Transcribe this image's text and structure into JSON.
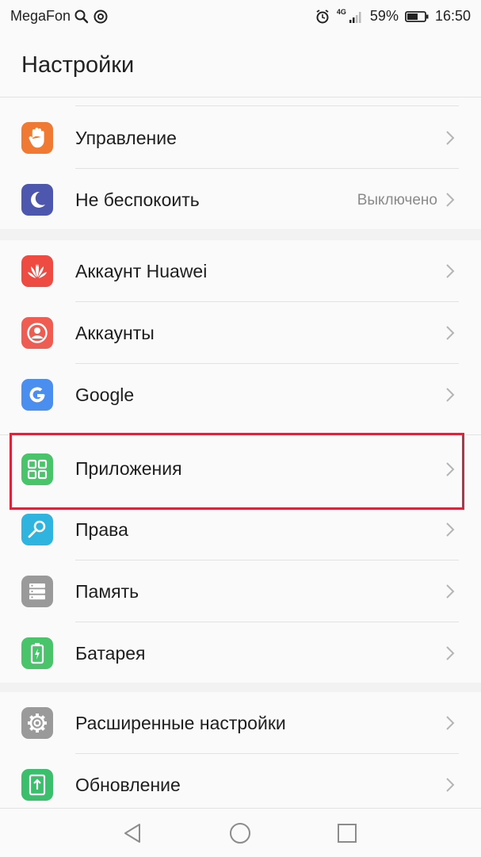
{
  "status": {
    "carrier": "MegaFon",
    "network": "4G",
    "battery": "59%",
    "time": "16:50",
    "icons": [
      "search-icon",
      "at-icon",
      "alarm-icon",
      "signal-icon",
      "battery-icon"
    ]
  },
  "header": {
    "title": "Настройки"
  },
  "settings": {
    "management": {
      "label": "Управление",
      "icon": "hand-icon",
      "color": "#f07a33"
    },
    "dnd": {
      "label": "Не беспокоить",
      "value": "Выключено",
      "icon": "moon-icon",
      "color": "#4e57ae"
    },
    "huawei_account": {
      "label": "Аккаунт Huawei",
      "icon": "huawei-icon",
      "color": "#ee4b43"
    },
    "accounts": {
      "label": "Аккаунты",
      "icon": "user-icon",
      "color": "#ee5c52"
    },
    "google": {
      "label": "Google",
      "icon": "google-icon",
      "color": "#4a8ef0"
    },
    "apps": {
      "label": "Приложения",
      "icon": "grid-icon",
      "color": "#49c46b"
    },
    "permissions": {
      "label": "Права",
      "icon": "key-icon",
      "color": "#2fb4e0"
    },
    "storage": {
      "label": "Память",
      "icon": "storage-icon",
      "color": "#9a9a9a"
    },
    "battery": {
      "label": "Батарея",
      "icon": "battery-icon",
      "color": "#49c46b"
    },
    "advanced": {
      "label": "Расширенные настройки",
      "icon": "gear-icon",
      "color": "#9a9a9a"
    },
    "update": {
      "label": "Обновление",
      "icon": "update-icon",
      "color": "#3cbf6d"
    }
  },
  "highlight_color": "#d0283c"
}
